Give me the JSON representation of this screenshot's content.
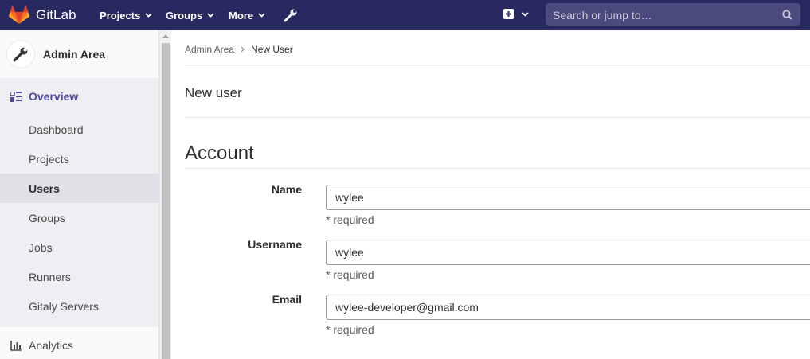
{
  "navbar": {
    "brand": "GitLab",
    "projects": "Projects",
    "groups": "Groups",
    "more": "More",
    "search_placeholder": "Search or jump to…",
    "bg_color": "#292961"
  },
  "sidebar": {
    "title": "Admin Area",
    "overview": "Overview",
    "items": [
      {
        "label": "Dashboard",
        "active": false
      },
      {
        "label": "Projects",
        "active": false
      },
      {
        "label": "Users",
        "active": true
      },
      {
        "label": "Groups",
        "active": false
      },
      {
        "label": "Jobs",
        "active": false
      },
      {
        "label": "Runners",
        "active": false
      },
      {
        "label": "Gitaly Servers",
        "active": false
      }
    ],
    "analytics": "Analytics"
  },
  "breadcrumb": {
    "parent": "Admin Area",
    "current": "New User"
  },
  "page": {
    "title": "New user",
    "section": "Account"
  },
  "form": {
    "name_label": "Name",
    "name_value": "wylee",
    "name_help": "* required",
    "username_label": "Username",
    "username_value": "wylee",
    "username_help": "* required",
    "email_label": "Email",
    "email_value": "wylee-developer@gmail.com",
    "email_help": "* required"
  }
}
